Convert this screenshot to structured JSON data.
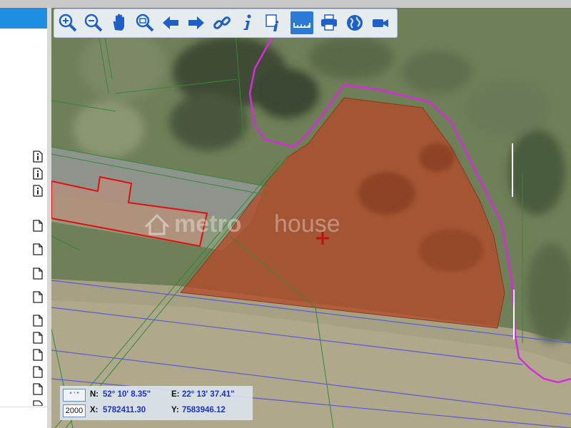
{
  "toolbar": {
    "tools": [
      {
        "name": "zoom-in-icon"
      },
      {
        "name": "zoom-out-icon"
      },
      {
        "name": "pan-hand-icon"
      },
      {
        "name": "zoom-extent-icon"
      },
      {
        "name": "arrow-left-icon"
      },
      {
        "name": "arrow-right-icon"
      },
      {
        "name": "link-icon"
      },
      {
        "name": "info-icon"
      },
      {
        "name": "info-document-icon"
      },
      {
        "name": "measure-ruler-icon",
        "active": true
      },
      {
        "name": "print-icon"
      },
      {
        "name": "globe-icon"
      },
      {
        "name": "video-camera-icon"
      }
    ]
  },
  "coordinates": {
    "format_button": "° ' \"",
    "scale_value": "2000",
    "n_label": "N:",
    "n_value": "52° 10' 8.35\"",
    "e_label": "E:",
    "e_value": "22° 13' 37.41\"",
    "x_label": "X:",
    "x_value": "5782411.30",
    "y_label": "Y:",
    "y_value": "7583946.12"
  },
  "watermark": {
    "text_a": "metro",
    "text_b": "house"
  },
  "colors": {
    "accent": "#1e8fe0",
    "parcel_fill": "#b44a2a",
    "boundary_magenta": "#d82ae0",
    "building_outline": "#e01010"
  }
}
